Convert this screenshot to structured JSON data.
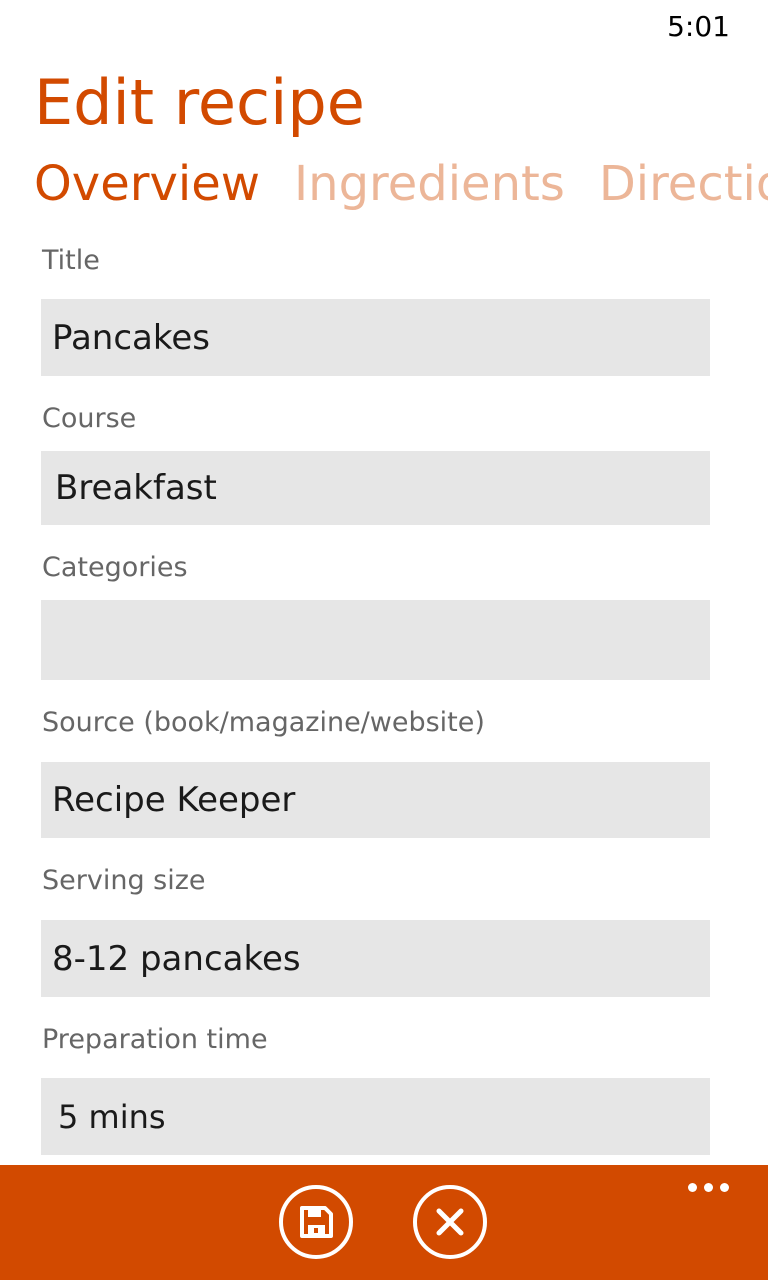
{
  "status_bar": {
    "time": "5:01"
  },
  "page": {
    "title": "Edit recipe"
  },
  "tabs": [
    {
      "label": "Overview",
      "active": true
    },
    {
      "label": "Ingredients",
      "active": false
    },
    {
      "label": "Directions",
      "active": false
    }
  ],
  "form": {
    "title": {
      "label": "Title",
      "value": "Pancakes"
    },
    "course": {
      "label": "Course",
      "value": "Breakfast"
    },
    "categories": {
      "label": "Categories",
      "value": ""
    },
    "source": {
      "label": "Source (book/magazine/website)",
      "value": "Recipe Keeper"
    },
    "serving_size": {
      "label": "Serving size",
      "value": "8-12 pancakes"
    },
    "preparation_time": {
      "label": "Preparation time",
      "value": "5 mins"
    }
  },
  "app_bar": {
    "buttons": [
      {
        "icon": "save-icon"
      },
      {
        "icon": "close-icon"
      }
    ],
    "more_icon": "more-dots-icon"
  },
  "colors": {
    "accent": "#d24a00",
    "input_background": "#e6e6e6",
    "label_text": "#666666"
  }
}
